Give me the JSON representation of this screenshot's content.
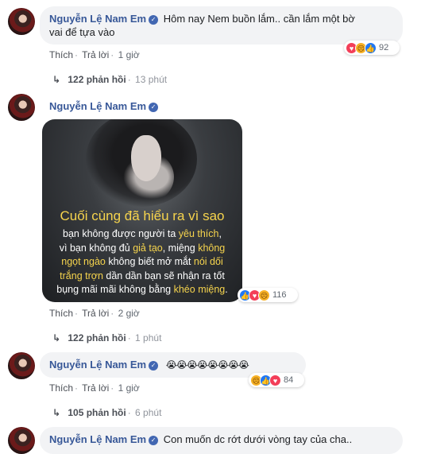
{
  "comments": [
    {
      "author": "Nguyễn Lệ Nam Em",
      "text_line1": "Hôm nay Nem buồn lắm.. cần lắm một bờ",
      "text_line2": "vai để tựa vào",
      "actions": {
        "like": "Thích",
        "reply": "Trả lời",
        "time": "1 giờ"
      },
      "reactions": {
        "icons": [
          "love-icon",
          "sad-icon",
          "like-icon"
        ],
        "count": "92"
      },
      "replies": {
        "count": "122 phản hồi",
        "time": "13 phút"
      }
    },
    {
      "author": "Nguyễn Lệ Nam Em",
      "image": {
        "headline": "Cuối cùng đã hiểu ra vì sao",
        "lines": [
          [
            "bạn không được người ta ",
            "yêu thích",
            ","
          ],
          [
            "vì bạn không đủ ",
            "giả tạo",
            ", miệng ",
            "không"
          ],
          [
            "ngọt ngào",
            " không biết mở mắt ",
            "nói dối"
          ],
          [
            "trắng trợn",
            " dần dần bạn sẽ nhận ra tốt"
          ],
          [
            "bụng mãi mãi không bằng ",
            "khéo miệng",
            "."
          ]
        ]
      },
      "actions": {
        "like": "Thích",
        "reply": "Trả lời",
        "time": "2 giờ"
      },
      "reactions": {
        "icons": [
          "like-icon",
          "love-icon",
          "sad-icon"
        ],
        "count": "116"
      },
      "replies": {
        "count": "122 phản hồi",
        "time": "1 phút"
      }
    },
    {
      "author": "Nguyễn Lệ Nam Em",
      "text_line1": "😭😭😭😭😭😭😭😭",
      "actions": {
        "like": "Thích",
        "reply": "Trả lời",
        "time": "1 giờ"
      },
      "reactions": {
        "icons": [
          "sad-icon",
          "like-icon",
          "love-icon"
        ],
        "count": "84"
      },
      "replies": {
        "count": "105 phản hồi",
        "time": "6 phút"
      }
    },
    {
      "author": "Nguyễn Lệ Nam Em",
      "text_line1": "Con muốn dc rớt dưới vòng tay của cha.."
    }
  ],
  "colors": {
    "name": "#385898",
    "bubble": "#f2f3f5",
    "like": "#2078f4",
    "love": "#f33e58",
    "sad": "#f7b125",
    "highlight": "#f6d44d"
  }
}
